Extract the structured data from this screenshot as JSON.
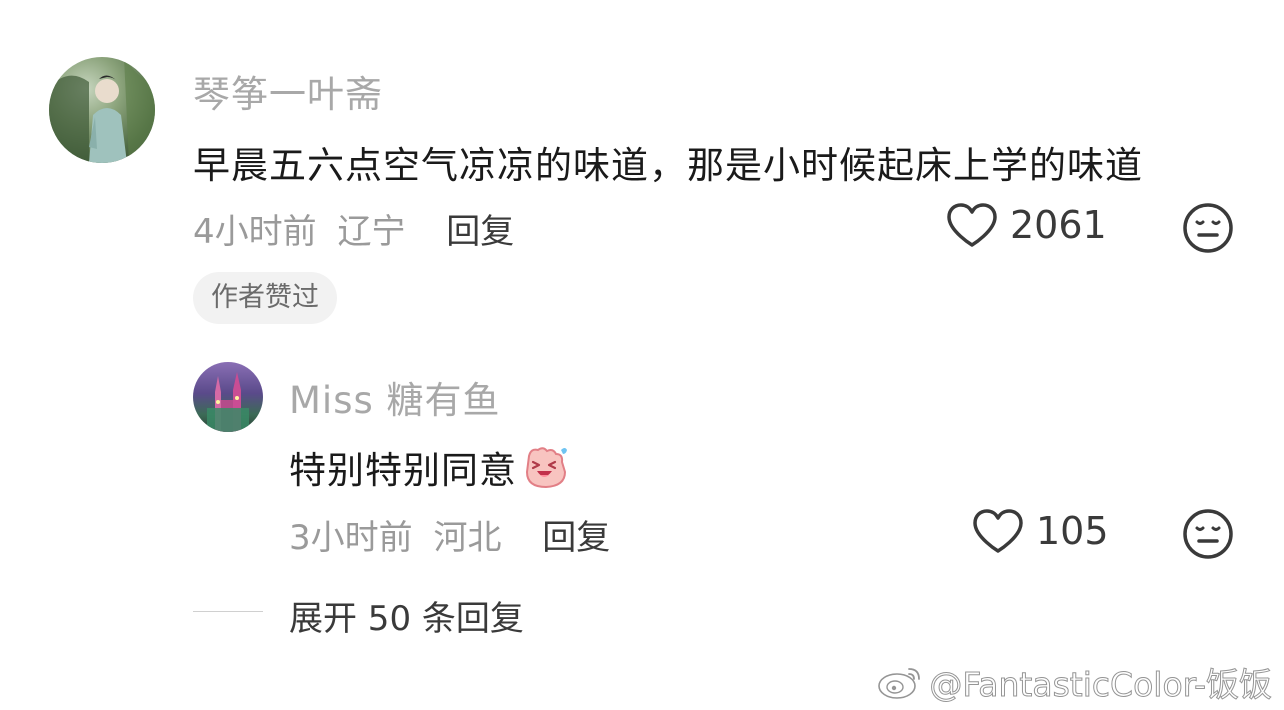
{
  "main_comment": {
    "username": "琴筝一叶斋",
    "content": "早晨五六点空气凉凉的味道，那是小时候起床上学的味道",
    "time": "4小时前",
    "location": "辽宁",
    "reply_label": "回复",
    "likes": "2061",
    "author_badge": "作者赞过"
  },
  "reply_comment": {
    "username": "Miss 糖有鱼",
    "content": "特别特别同意",
    "time": "3小时前",
    "location": "河北",
    "reply_label": "回复",
    "likes": "105"
  },
  "expand_replies": "展开 50 条回复",
  "watermark": "@FantasticColor-饭饭",
  "icons": {
    "like": "heart-outline-icon",
    "dislike": "neutral-face-icon",
    "emoji": "laughing-face-emoji",
    "watermark": "weibo-logo-icon"
  }
}
